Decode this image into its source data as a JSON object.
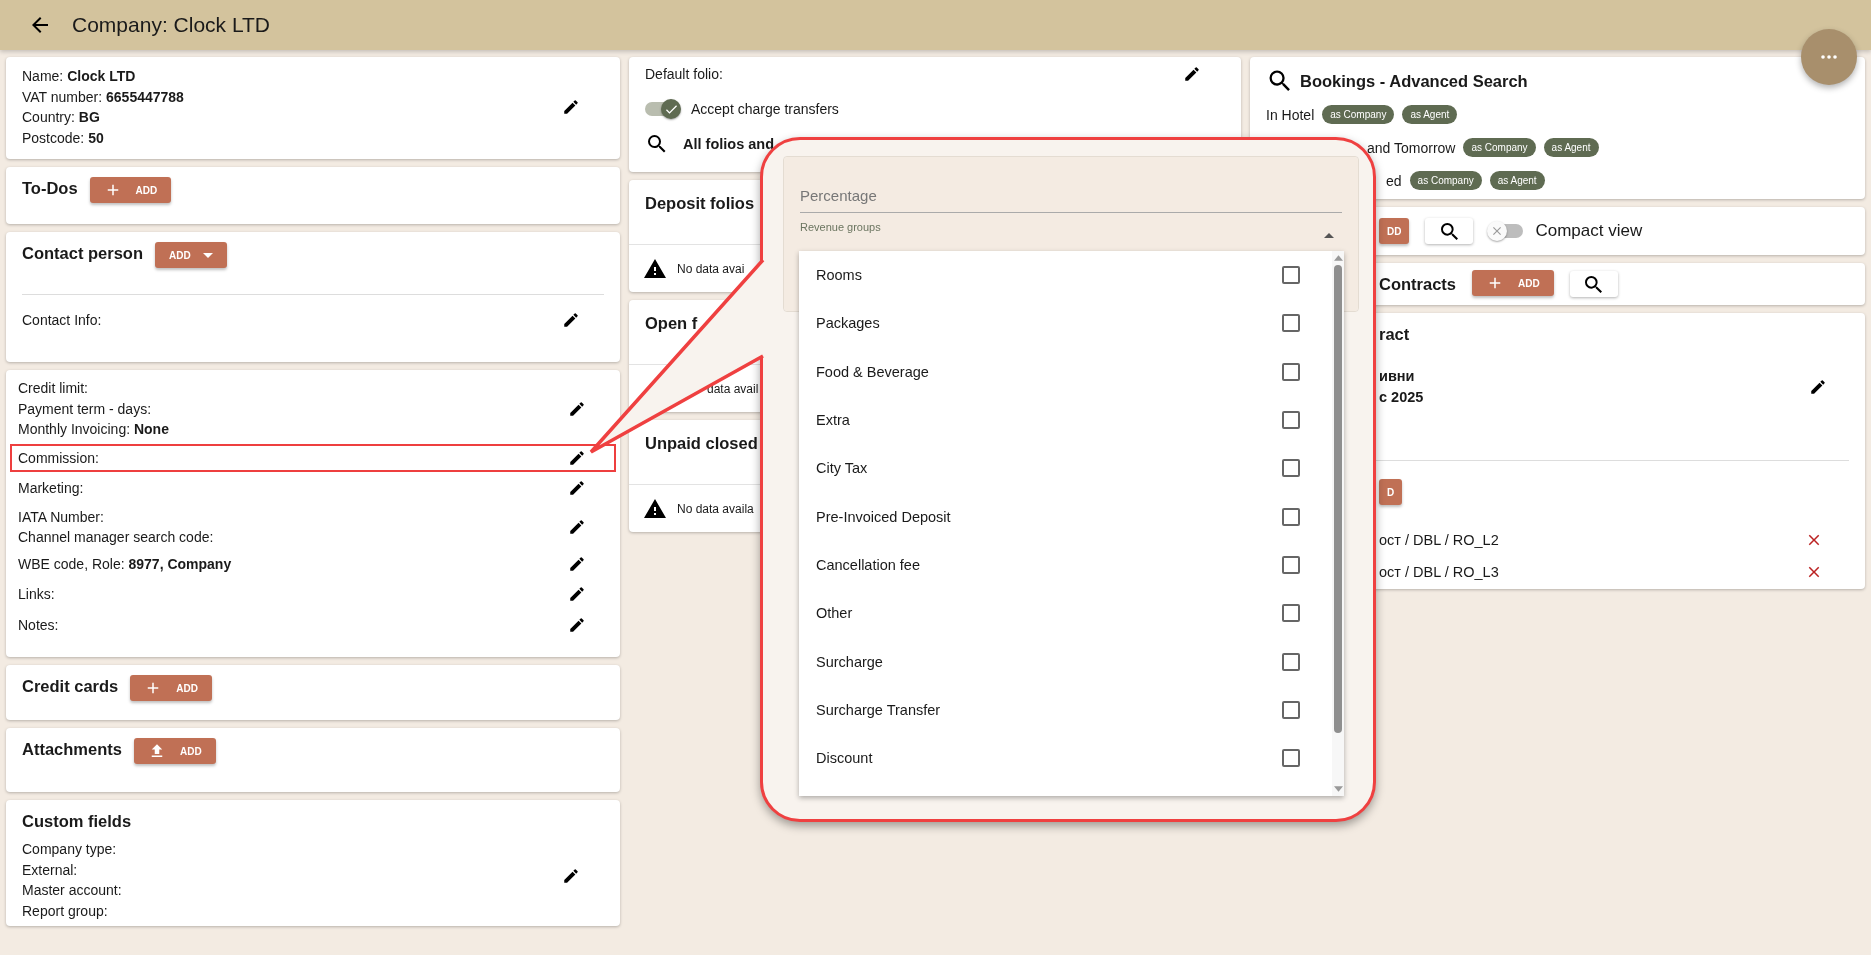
{
  "header": {
    "title": "Company: Clock LTD"
  },
  "company": {
    "fields": [
      {
        "label": "Name:",
        "value": "Clock LTD"
      },
      {
        "label": "VAT number:",
        "value": "6655447788"
      },
      {
        "label": "Country:",
        "value": "BG"
      },
      {
        "label": "Postcode:",
        "value": "50"
      }
    ]
  },
  "todos": {
    "title": "To-Dos",
    "button": {
      "label": "ADD"
    }
  },
  "contact_person": {
    "title": "Contact person",
    "button": {
      "label": "ADD"
    },
    "contact_info": "Contact Info:"
  },
  "finance": {
    "groups": [
      {
        "highlighted": false,
        "fields": [
          {
            "label": "Credit limit:"
          },
          {
            "label": "Payment term - days:"
          },
          {
            "label": "Monthly Invoicing:",
            "value": "None"
          }
        ]
      },
      {
        "highlighted": true,
        "fields": [
          {
            "label": "Commission:"
          }
        ]
      },
      {
        "highlighted": false,
        "fields": [
          {
            "label": "Marketing:"
          }
        ]
      },
      {
        "highlighted": false,
        "fields": [
          {
            "label": "IATA Number:"
          },
          {
            "label": "Channel manager search code:"
          }
        ]
      },
      {
        "highlighted": false,
        "fields": [
          {
            "label": "WBE code, Role:",
            "value": "8977, Company"
          }
        ]
      },
      {
        "highlighted": false,
        "fields": [
          {
            "label": "Links:"
          }
        ]
      },
      {
        "highlighted": false,
        "fields": [
          {
            "label": "Notes:"
          }
        ]
      }
    ]
  },
  "credit_cards": {
    "title": "Credit cards",
    "button": {
      "label": "ADD"
    }
  },
  "attachments": {
    "title": "Attachments",
    "button": {
      "label": "ADD"
    }
  },
  "custom_fields": {
    "title": "Custom fields",
    "fields": [
      "Company type:",
      "External:",
      "Master account:",
      "Report group:"
    ]
  },
  "folios": {
    "default_folio": "Default folio:",
    "accept_transfers": {
      "label": "Accept charge transfers",
      "on": true
    },
    "search_link": "All folios and"
  },
  "folio_cards": [
    {
      "title": "Deposit folios",
      "empty": "No data avai"
    },
    {
      "title": "Open f",
      "empty": "data avail"
    },
    {
      "title": "Unpaid closed",
      "empty": "No data availa"
    }
  ],
  "bookings": {
    "title": "Bookings - Advanced Search",
    "rows": [
      {
        "label": "In Hotel",
        "chips": [
          "as Company",
          "as Agent"
        ]
      },
      {
        "label": "and Tomorrow",
        "chips": [
          "as Company",
          "as Agent"
        ]
      },
      {
        "label": "ed",
        "chips": [
          "as Company",
          "as Agent"
        ]
      }
    ]
  },
  "toolbar": {
    "button": "DD",
    "compact_view": {
      "label": "Compact view",
      "on": false
    }
  },
  "contracts": {
    "title": "Contracts",
    "button": {
      "label": "ADD"
    }
  },
  "contract": {
    "title": "ract",
    "lines": [
      "ивни",
      "с 2025"
    ],
    "button": "D",
    "rates": [
      "ост / DBL / RO_L2",
      "ост / DBL / RO_L3"
    ]
  },
  "commission_popup": {
    "percentage": {
      "placeholder": "Percentage"
    },
    "revenue_groups": {
      "label": "Revenue groups",
      "expanded": true,
      "options": [
        {
          "label": "Rooms",
          "checked": false
        },
        {
          "label": "Packages",
          "checked": false
        },
        {
          "label": "Food & Beverage",
          "checked": false
        },
        {
          "label": "Extra",
          "checked": false
        },
        {
          "label": "City Tax",
          "checked": false
        },
        {
          "label": "Pre-Invoiced Deposit",
          "checked": false
        },
        {
          "label": "Cancellation fee",
          "checked": false
        },
        {
          "label": "Other",
          "checked": false
        },
        {
          "label": "Surcharge",
          "checked": false
        },
        {
          "label": "Surcharge Transfer",
          "checked": false
        },
        {
          "label": "Discount",
          "checked": false
        }
      ]
    }
  }
}
